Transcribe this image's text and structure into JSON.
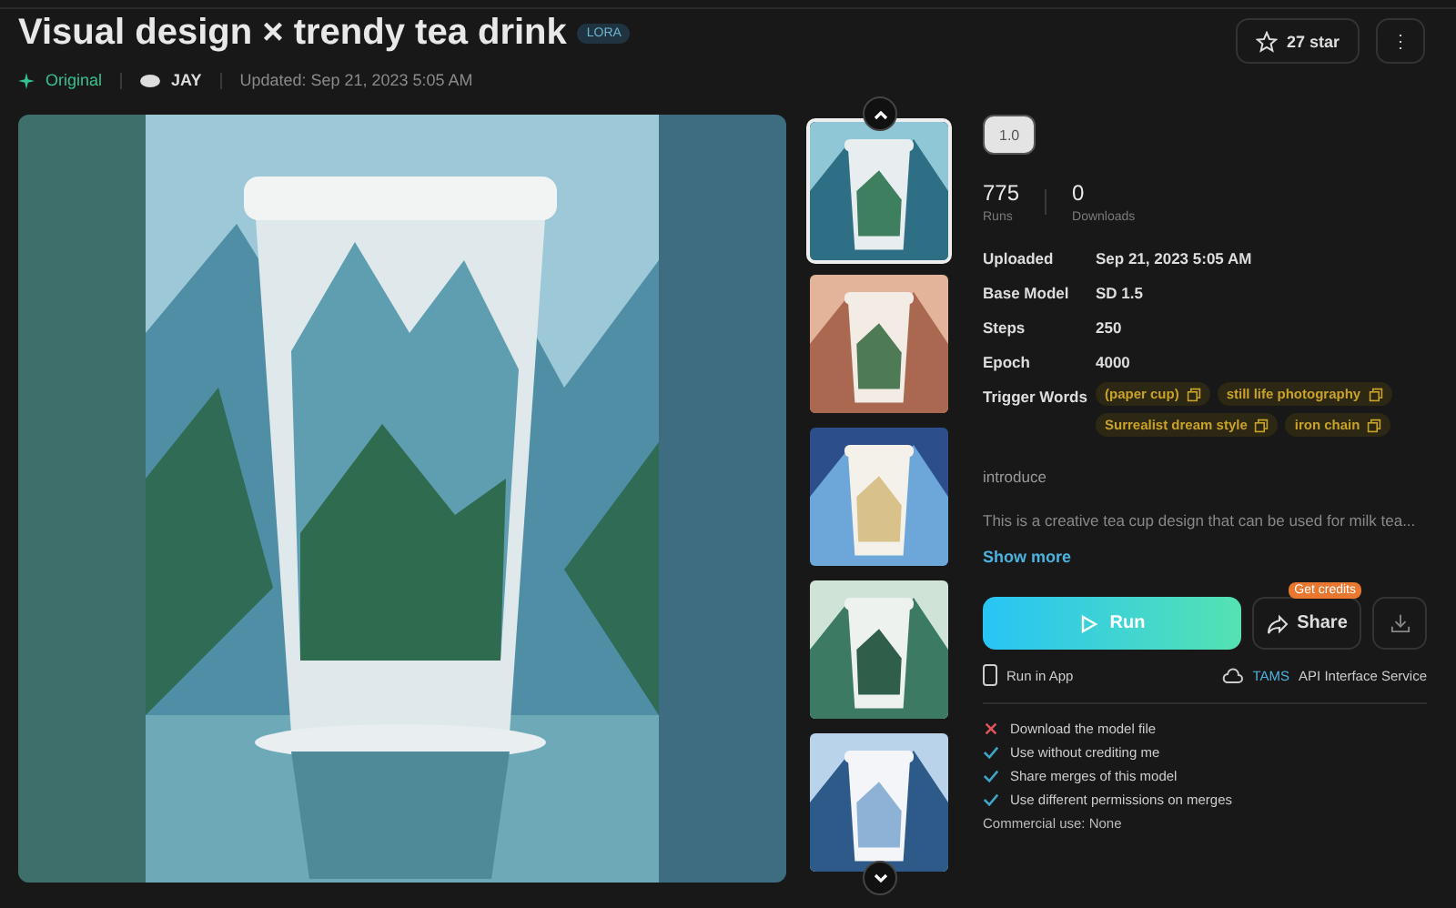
{
  "title": "Visual design × trendy tea drink",
  "badge": "LORA",
  "meta": {
    "origin": "Original",
    "author": "JAY",
    "updated": "Updated: Sep 21, 2023 5:05 AM"
  },
  "star_button": {
    "label": "27 star"
  },
  "more_button": {
    "label": "⋮"
  },
  "thumbnails": [
    {
      "selected": true
    },
    {
      "selected": false
    },
    {
      "selected": false
    },
    {
      "selected": false
    },
    {
      "selected": false
    }
  ],
  "version": {
    "label": "1.0",
    "selected": true
  },
  "stats": [
    {
      "value": "775",
      "label": "Runs"
    },
    {
      "value": "0",
      "label": "Downloads"
    }
  ],
  "details": [
    {
      "label": "Uploaded",
      "value": "Sep 21, 2023 5:05 AM"
    },
    {
      "label": "Base Model",
      "value": "SD 1.5"
    },
    {
      "label": "Steps",
      "value": "250"
    },
    {
      "label": "Epoch",
      "value": "4000"
    }
  ],
  "trigger_words": {
    "label": "Trigger Words",
    "tags": [
      "(paper cup)",
      "still life photography",
      "Surrealist dream style",
      "iron chain"
    ]
  },
  "introduce": {
    "heading": "introduce",
    "text": "This is a creative tea cup design that can be used for milk tea...",
    "show_more": "Show more"
  },
  "run_button": {
    "label": "Run"
  },
  "share_button": {
    "label": "Share",
    "badge": "Get credits"
  },
  "run_in_app": "Run in App",
  "api": {
    "brand": "TAMS",
    "text": "API Interface Service"
  },
  "permissions": [
    {
      "text": "Download the model file",
      "allowed": false
    },
    {
      "text": "Use without crediting me",
      "allowed": true
    },
    {
      "text": "Share merges of this model",
      "allowed": true
    },
    {
      "text": "Use different permissions on merges",
      "allowed": true
    }
  ],
  "commercial_use": "Commercial use: None"
}
